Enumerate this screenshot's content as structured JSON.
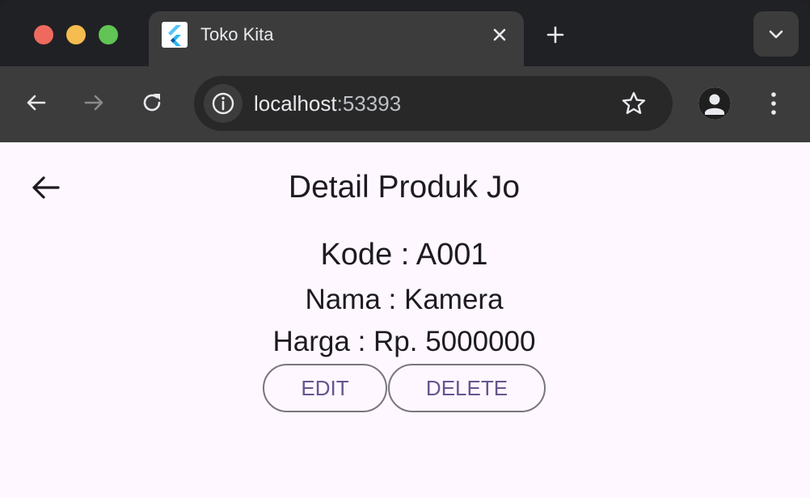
{
  "browser": {
    "tab": {
      "title": "Toko Kita",
      "favicon": "flutter-icon"
    },
    "url_host": "localhost",
    "url_port": ":53393",
    "colors": {
      "chrome_dark": "#202124",
      "chrome_tab": "#3c3c3c"
    }
  },
  "app": {
    "title": "Detail Produk Jo",
    "product": {
      "kode": "Kode : A001",
      "nama": "Nama : Kamera",
      "harga": "Harga : Rp. 5000000"
    },
    "buttons": {
      "edit": "EDIT",
      "delete": "DELETE"
    },
    "colors": {
      "background": "#fef7ff",
      "button_text": "#65558f",
      "button_border": "#79747e"
    }
  }
}
